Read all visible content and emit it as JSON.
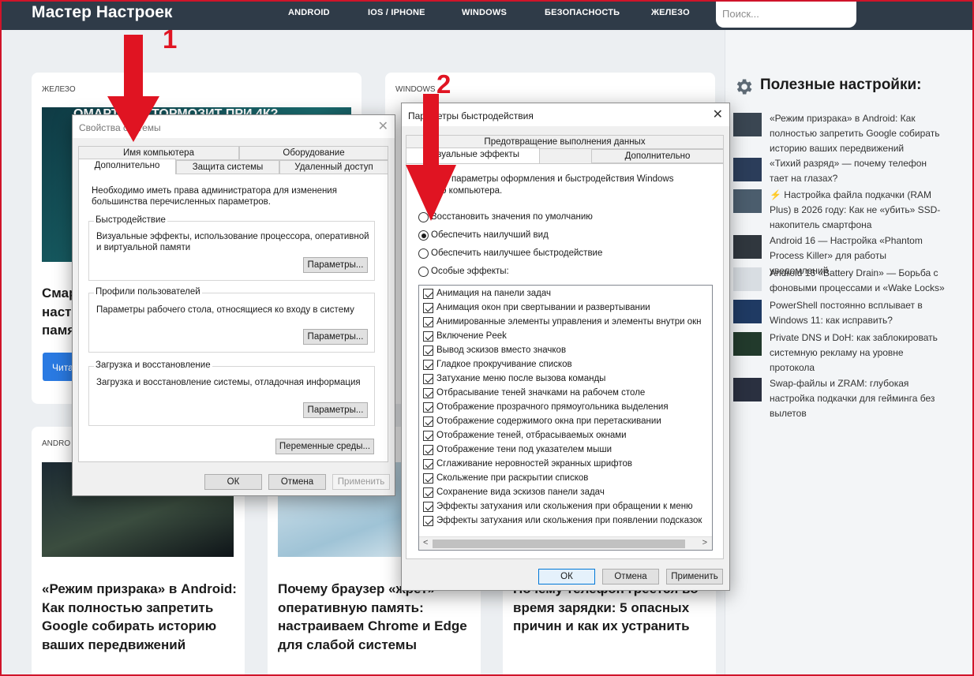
{
  "site": {
    "logo": "Мастер Настроек",
    "nav": [
      "ANDROID",
      "IOS / IPHONE",
      "WINDOWS",
      "БЕЗОПАСНОСТЬ",
      "ЖЕЛЕЗО"
    ],
    "search_placeholder": "Поиск..."
  },
  "cards": [
    {
      "category": "ЖЕЛЕЗО",
      "title_lines": [
        "Смар",
        "наст",
        "памя"
      ],
      "button": "Чита",
      "thumb_text": "ОМАРТФОН ТОРМОЗИТ ПРИ 4К?"
    },
    {
      "category": "WINDOWS"
    },
    {
      "category": "ANDRO",
      "title": "«Режим призрака» в Android: Как полностью запретить Google собирать историю ваших передвижений"
    },
    {
      "title": "Почему браузер «жрет» оперативную память: настраиваем Chrome и Edge для слабой системы"
    },
    {
      "title": "Почему телефон греется во время зарядки: 5 опасных причин и как их устранить"
    }
  ],
  "sidebar": {
    "title": "Полезные настройки:",
    "items": [
      "«Режим призрака» в Android: Как полностью запретить Google собирать историю ваших передвижений",
      "«Тихий разряд» — почему телефон тает на глазах?",
      "⚡ Настройка файла подкачки (RAM Plus) в 2026 году: Как не «убить» SSD-накопитель смартфона",
      "Android 16 — Настройка «Phantom Process Killer» для работы уведомлений",
      "Android 16 «Battery Drain» — Борьба с фоновыми процессами и «Wake Locks»",
      "PowerShell постоянно всплывает в Windows 11: как исправить?",
      "Private DNS и DoH: как заблокировать системную рекламу на уровне протокола",
      "Swap-файлы и ZRAM: глубокая настройка подкачки для гейминга без вылетов"
    ]
  },
  "sysprops": {
    "title": "Свойства системы",
    "close": "✕",
    "tabs_top": [
      "Имя компьютера",
      "Оборудование"
    ],
    "tabs_bottom": [
      "Дополнительно",
      "Защита системы",
      "Удаленный доступ"
    ],
    "admin_note": "Необходимо иметь права администратора для изменения большинства перечисленных параметров.",
    "groups": [
      {
        "label": "Быстродействие",
        "text": "Визуальные эффекты, использование процессора, оперативной и виртуальной памяти",
        "button": "Параметры..."
      },
      {
        "label": "Профили пользователей",
        "text": "Параметры рабочего стола, относящиеся ко входу в систему",
        "button": "Параметры..."
      },
      {
        "label": "Загрузка и восстановление",
        "text": "Загрузка и восстановление системы, отладочная информация",
        "button": "Параметры..."
      }
    ],
    "env_button": "Переменные среды...",
    "ok": "ОК",
    "cancel": "Отмена",
    "apply": "Применить"
  },
  "perf": {
    "title": "Параметры быстродействия",
    "close": "✕",
    "tab_dep": "Предотвращение выполнения данных",
    "tab_visual": "Визуальные эффекты",
    "tab_advanced": "Дополнительно",
    "intro": [
      "ерите параметры оформления и быстродействия Windows",
      "этого компьютера."
    ],
    "radios": [
      {
        "label": "Восстановить значения по умолчанию",
        "selected": false
      },
      {
        "label": "Обеспечить наилучший вид",
        "selected": true
      },
      {
        "label": "Обеспечить наилучшее быстродействие",
        "selected": false
      },
      {
        "label": "Особые эффекты:",
        "selected": false
      }
    ],
    "effects": [
      "Анимация на панели задач",
      "Анимация окон при свертывании и развертывании",
      "Анимированные элементы управления и элементы внутри окн",
      "Включение Peek",
      "Вывод эскизов вместо значков",
      "Гладкое прокручивание списков",
      "Затухание меню после вызова команды",
      "Отбрасывание теней значками на рабочем столе",
      "Отображение прозрачного прямоугольника выделения",
      "Отображение содержимого окна при перетаскивании",
      "Отображение теней, отбрасываемых окнами",
      "Отображение тени под указателем мыши",
      "Сглаживание неровностей экранных шрифтов",
      "Скольжение при раскрытии списков",
      "Сохранение вида эскизов панели задач",
      "Эффекты затухания или скольжения при обращении к меню",
      "Эффекты затухания или скольжения при появлении подсказок"
    ],
    "scroll_left": "<",
    "scroll_right": ">",
    "ok": "ОК",
    "cancel": "Отмена",
    "apply": "Применить"
  },
  "annotations": {
    "arrow1": "1",
    "arrow2": "2",
    "color": "#e01422"
  }
}
